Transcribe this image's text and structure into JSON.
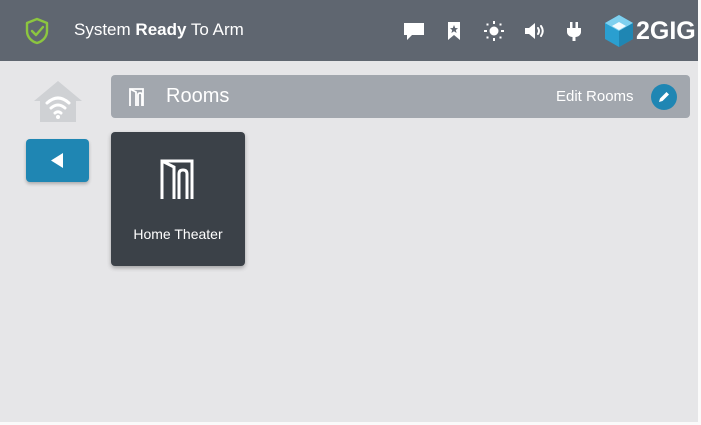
{
  "status": {
    "prefix": "System",
    "bold": "Ready",
    "suffix": "To Arm"
  },
  "brand": {
    "name": "2GIG"
  },
  "rooms_bar": {
    "title": "Rooms",
    "edit_label": "Edit Rooms"
  },
  "rooms": [
    {
      "label": "Home Theater"
    }
  ],
  "icons": {
    "status_shield": "shield-check-icon",
    "messages": "message-icon",
    "bookmark": "bookmark-icon",
    "brightness": "brightness-icon",
    "volume": "speaker-icon",
    "power": "power-plug-icon",
    "home": "home-wifi-icon",
    "back": "back-arrow-icon",
    "rooms": "door-icon",
    "edit": "pencil-icon"
  },
  "colors": {
    "topbar": "#5f6670",
    "accent": "#1f86b3",
    "shield_green": "#8cc63f",
    "background": "#e6e6e8",
    "rooms_bar": "#a2a7ae",
    "tile": "#3b4148"
  }
}
